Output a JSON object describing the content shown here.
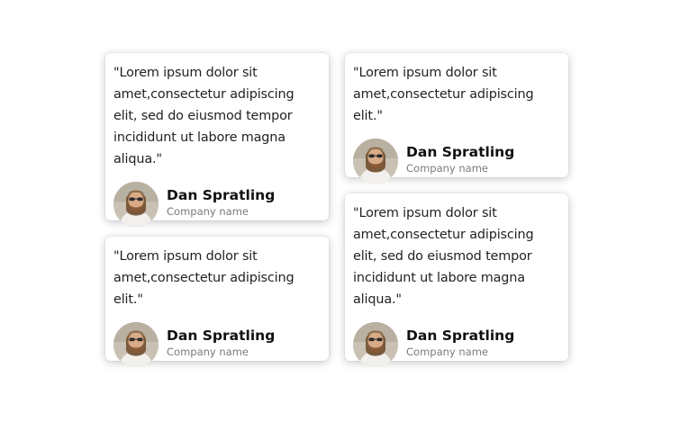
{
  "testimonials": [
    {
      "quote": "\"Lorem ipsum dolor sit amet,consectetur adipiscing elit, sed do eiusmod tempor incididunt ut labore magna aliqua.\"",
      "author_name": "Dan Spratling",
      "company": "Company name"
    },
    {
      "quote": "\"Lorem ipsum dolor sit amet,consectetur adipiscing elit.\"",
      "author_name": "Dan Spratling",
      "company": "Company name"
    },
    {
      "quote": "\"Lorem ipsum dolor sit amet,consectetur adipiscing elit.\"",
      "author_name": "Dan Spratling",
      "company": "Company name"
    },
    {
      "quote": "\"Lorem ipsum dolor sit amet,consectetur adipiscing elit, sed do eiusmod tempor incididunt ut labore magna aliqua.\"",
      "author_name": "Dan Spratling",
      "company": "Company name"
    }
  ],
  "avatar_icon": "person-photo-icon"
}
